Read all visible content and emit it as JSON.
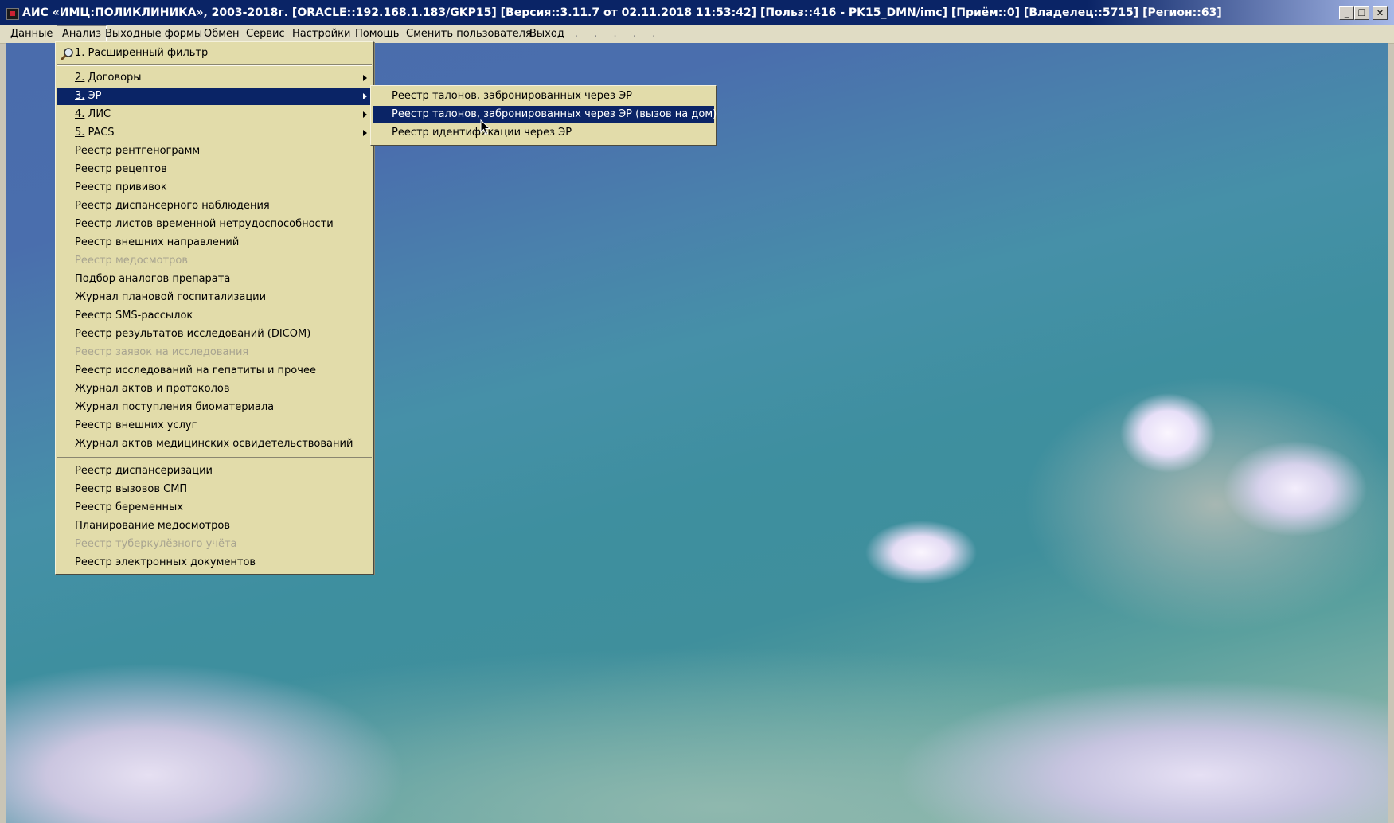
{
  "window": {
    "title": "АИС «ИМЦ:ПОЛИКЛИНИКА», 2003-2018г.  [ORACLE::192.168.1.183/GKP15] [Версия::3.11.7 от 02.11.2018 11:53:42] [Польз::416 - PK15_DMN/imc] [Приём::0] [Владелец::5715] [Регион::63]",
    "icon": "app-icon",
    "controls": {
      "minimize": "_",
      "restore": "❐",
      "close": "✕"
    }
  },
  "menubar": {
    "items": [
      "Данные",
      "Анализ",
      "Выходные формы",
      "Обмен",
      "Сервис",
      "Настройки",
      "Помощь",
      "Сменить пользователя",
      "Выход"
    ],
    "dots": ". . . . ."
  },
  "analysis_menu": {
    "filter": {
      "num": "1.",
      "label": "Расширенный фильтр",
      "icon": "magnifier-icon"
    },
    "submenus": [
      {
        "num": "2.",
        "label": "Договоры"
      },
      {
        "num": "3.",
        "label": "ЭР"
      },
      {
        "num": "4.",
        "label": "ЛИС"
      },
      {
        "num": "5.",
        "label": "PACS"
      }
    ],
    "group1": [
      "Реестр рентгенограмм",
      "Реестр рецептов",
      "Реестр прививок",
      "Реестр диспансерного наблюдения",
      "Реестр листов временной нетрудоспособности",
      "Реестр внешних направлений",
      "Реестр медосмотров",
      "Подбор аналогов препарата",
      "Журнал плановой госпитализации",
      "Реестр SMS-рассылок",
      "Реестр результатов исследований (DICOM)",
      "Реестр заявок на исследования",
      "Реестр исследований на гепатиты и прочее",
      "Журнал актов и протоколов",
      "Журнал поступления биоматериала",
      "Реестр внешних услуг",
      "Журнал актов медицинских освидетельствований"
    ],
    "group2": [
      "Реестр диспансеризации",
      "Реестр вызовов СМП",
      "Реестр беременных",
      "Планирование медосмотров",
      "Реестр туберкулёзного учёта",
      "Реестр электронных документов"
    ]
  },
  "er_submenu": {
    "items": [
      "Реестр талонов, забронированных через ЭР",
      "Реестр талонов, забронированных через ЭР (вызов на дом)",
      "Реестр идентификации через ЭР"
    ]
  }
}
